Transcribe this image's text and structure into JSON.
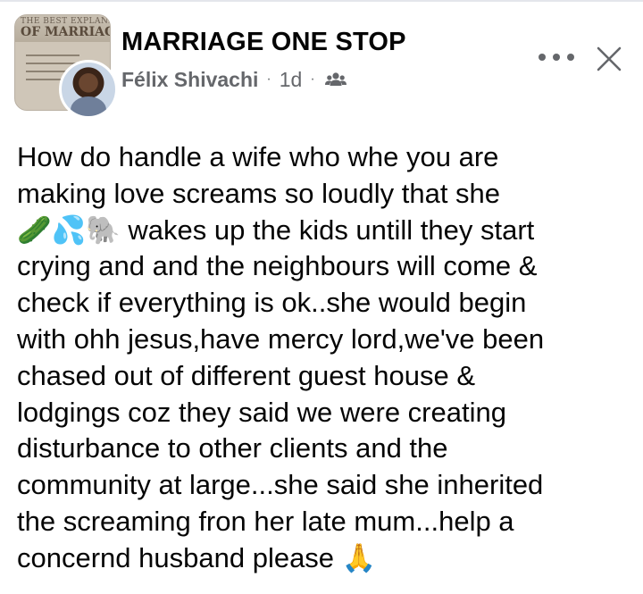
{
  "group": {
    "name": "MARRIAGE ONE STOP",
    "thumbnail_kicker": "THE BEST EXPLANATION",
    "thumbnail_title": "OF MARRIAGE"
  },
  "post": {
    "author": "Félix Shivachi",
    "separator": "·",
    "time": "1d",
    "audience_icon": "group-audience-icon",
    "text": "How do handle a wife who whe you are\nmaking love screams so loudly that she\n🥒💦🐘 wakes up the kids untill they start\ncrying and and the neighbours will come &\ncheck if everything is ok..she would begin\nwith ohh jesus,have mercy lord,we've been\nchased out of different guest house &\nlodgings coz they said we were creating\ndisturbance to other clients and the\ncommunity at large...she said she inherited\nthe screaming fron her late mum...help a\nconcernd husband please 🙏"
  },
  "controls": {
    "more_icon": "more-options-icon",
    "close_icon": "close-icon"
  },
  "colors": {
    "text_primary": "#050505",
    "text_secondary": "#65676b",
    "background": "#ffffff"
  }
}
